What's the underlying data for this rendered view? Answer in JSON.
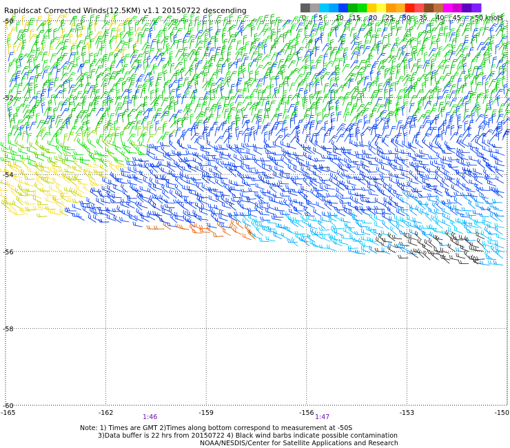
{
  "title": "Rapidscat Corrected Winds(12.5KM) v1.1 20150722 descending",
  "colorbar": {
    "labels": [
      "0",
      "5",
      "10",
      "15",
      "20",
      "25",
      "30",
      "35",
      "40",
      "45",
      ">50 knots"
    ],
    "colors": [
      "#606060",
      "#a0a0a0",
      "#00c8ff",
      "#00a0ff",
      "#0040ff",
      "#00b400",
      "#00e000",
      "#ffd000",
      "#ffff40",
      "#ff9a00",
      "#ffb020",
      "#ff2000",
      "#ff5050",
      "#8a4a20",
      "#c07040",
      "#ff00ff",
      "#d000d0",
      "#6000c0",
      "#8020ff"
    ]
  },
  "chart_data": {
    "type": "scatter",
    "title": "Rapidscat Corrected Winds(12.5KM) v1.1 20150722 descending",
    "xlabel": "",
    "ylabel": "",
    "x_range": [
      -165,
      -150
    ],
    "y_range": [
      -60,
      -50
    ],
    "x_ticks": [
      "-165",
      "-162",
      "-159",
      "-156",
      "-153",
      "-150"
    ],
    "y_ticks": [
      "-50",
      "-52",
      "-54",
      "-56",
      "-58",
      "-60"
    ],
    "grid": true,
    "times": [
      {
        "label": "1:46",
        "lon": -161.0
      },
      {
        "label": "1:47",
        "lon": -155.6
      }
    ],
    "speed_bands_knots": [
      {
        "region": "north (-50 to -53)",
        "speed": "15-20"
      },
      {
        "region": "southwest edge (-53 to -55.5, -165 to -160)",
        "speed": "20-25"
      },
      {
        "region": "center (-53 to -55)",
        "speed": "10-15"
      },
      {
        "region": "southeast (-55 to -56.5)",
        "speed": "5-10"
      },
      {
        "region": "swath edge near -56 -161 to -158",
        "speed": "25-35"
      }
    ]
  },
  "notes": {
    "line1": "Note: 1) Times are GMT 2)Times along bottom correspond to measurement at -50S",
    "line2": "3)Data buffer is 22 hrs from 20150722 4) Black wind barbs indicate possible contamination",
    "line3": "NOAA/NESDIS/Center for Satellite Applications and Research"
  }
}
